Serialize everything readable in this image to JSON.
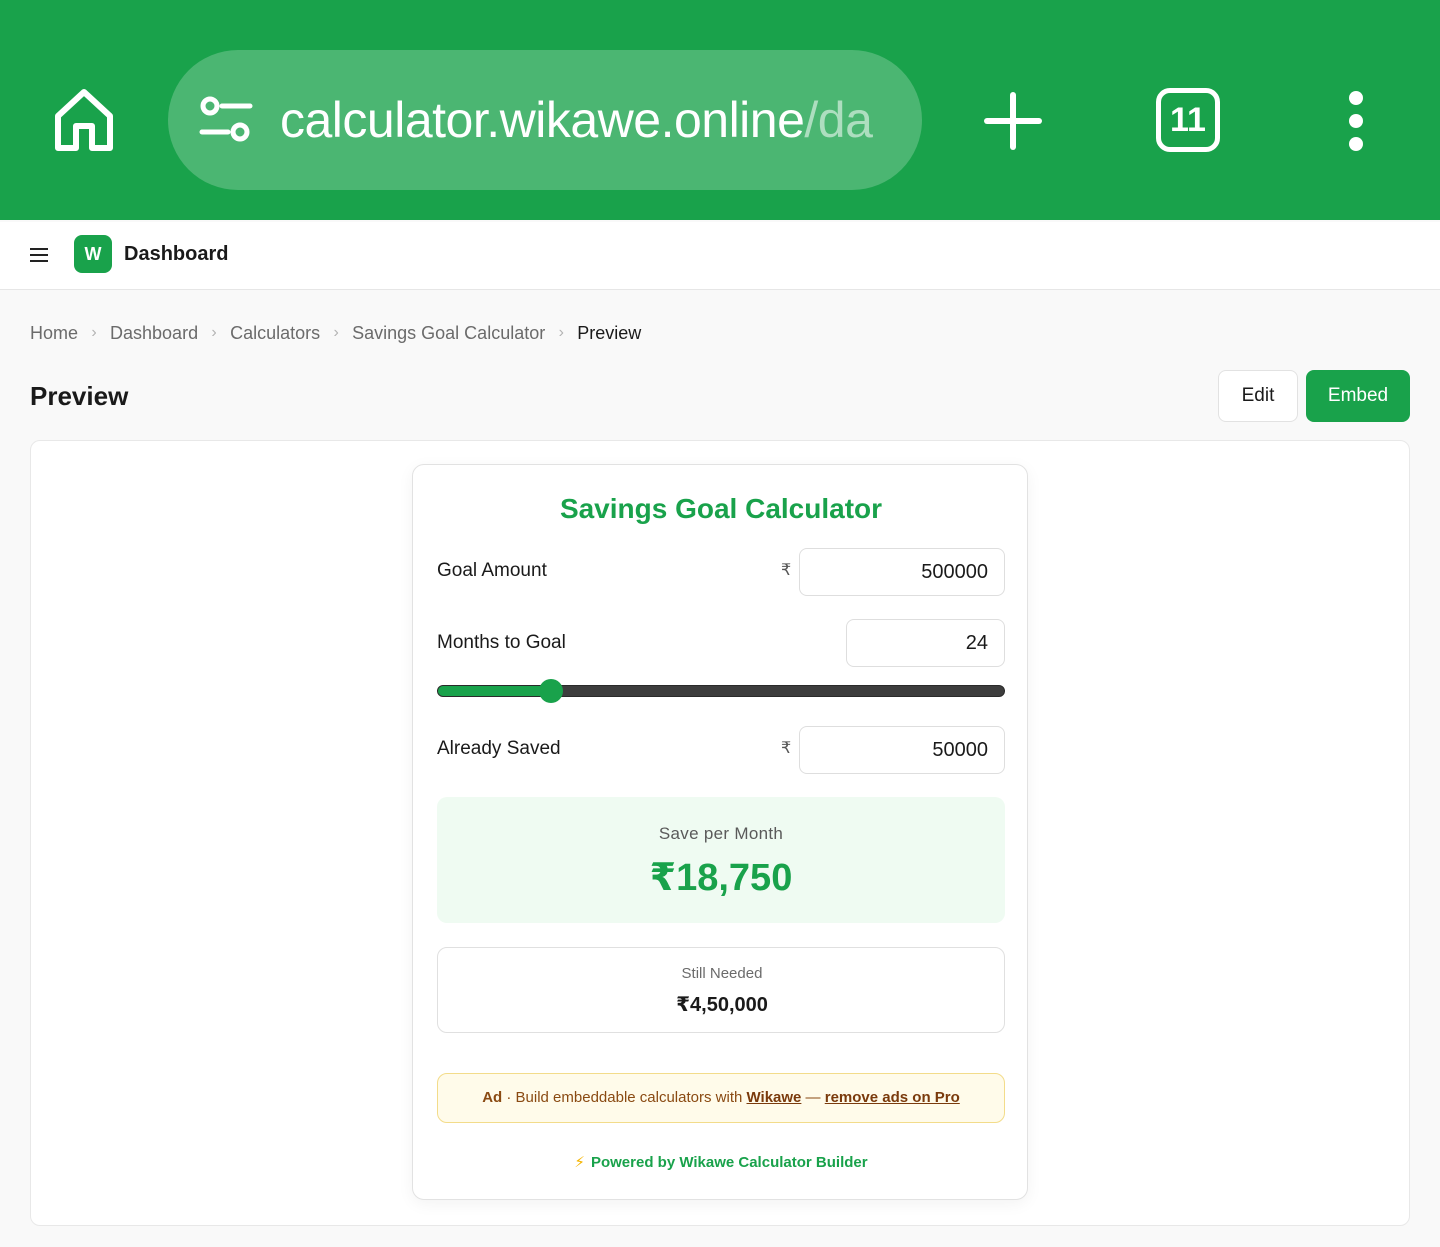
{
  "browser": {
    "url_host": "calculator.wikawe.online",
    "url_path": "/da",
    "tab_count": "11"
  },
  "app": {
    "logo_letter": "W",
    "title": "Dashboard"
  },
  "breadcrumb": {
    "items": [
      "Home",
      "Dashboard",
      "Calculators",
      "Savings Goal Calculator",
      "Preview"
    ]
  },
  "page": {
    "title": "Preview",
    "edit_label": "Edit",
    "embed_label": "Embed"
  },
  "calculator": {
    "title": "Savings Goal Calculator",
    "currency_symbol": "₹",
    "goal_amount": {
      "label": "Goal Amount",
      "value": "500000"
    },
    "months": {
      "label": "Months to Goal",
      "value": "24",
      "slider_fraction": 0.2
    },
    "already_saved": {
      "label": "Already Saved",
      "value": "50000"
    },
    "result": {
      "label": "Save per Month",
      "value": "₹18,750"
    },
    "needed": {
      "label": "Still Needed",
      "value": "₹4,50,000"
    },
    "ad": {
      "tag": "Ad",
      "text": " · Build embeddable calculators with ",
      "brand_link": "Wikawe",
      "dash": " — ",
      "pro_link": "remove ads on Pro"
    },
    "powered_by": "Powered by Wikawe Calculator Builder"
  },
  "colors": {
    "brand_green": "#19a24b",
    "browser_bar": "#19a24b",
    "result_bg": "#effbf2",
    "ad_bg": "#fffbea"
  },
  "icons": {
    "home": "home-icon",
    "site_settings": "tune-icon",
    "new_tab": "plus-icon",
    "tabs": "tab-count-icon",
    "overflow": "more-vert-icon",
    "menu": "hamburger-icon",
    "breadcrumb_sep": "chevron-right-icon",
    "powered": "bolt-icon"
  }
}
